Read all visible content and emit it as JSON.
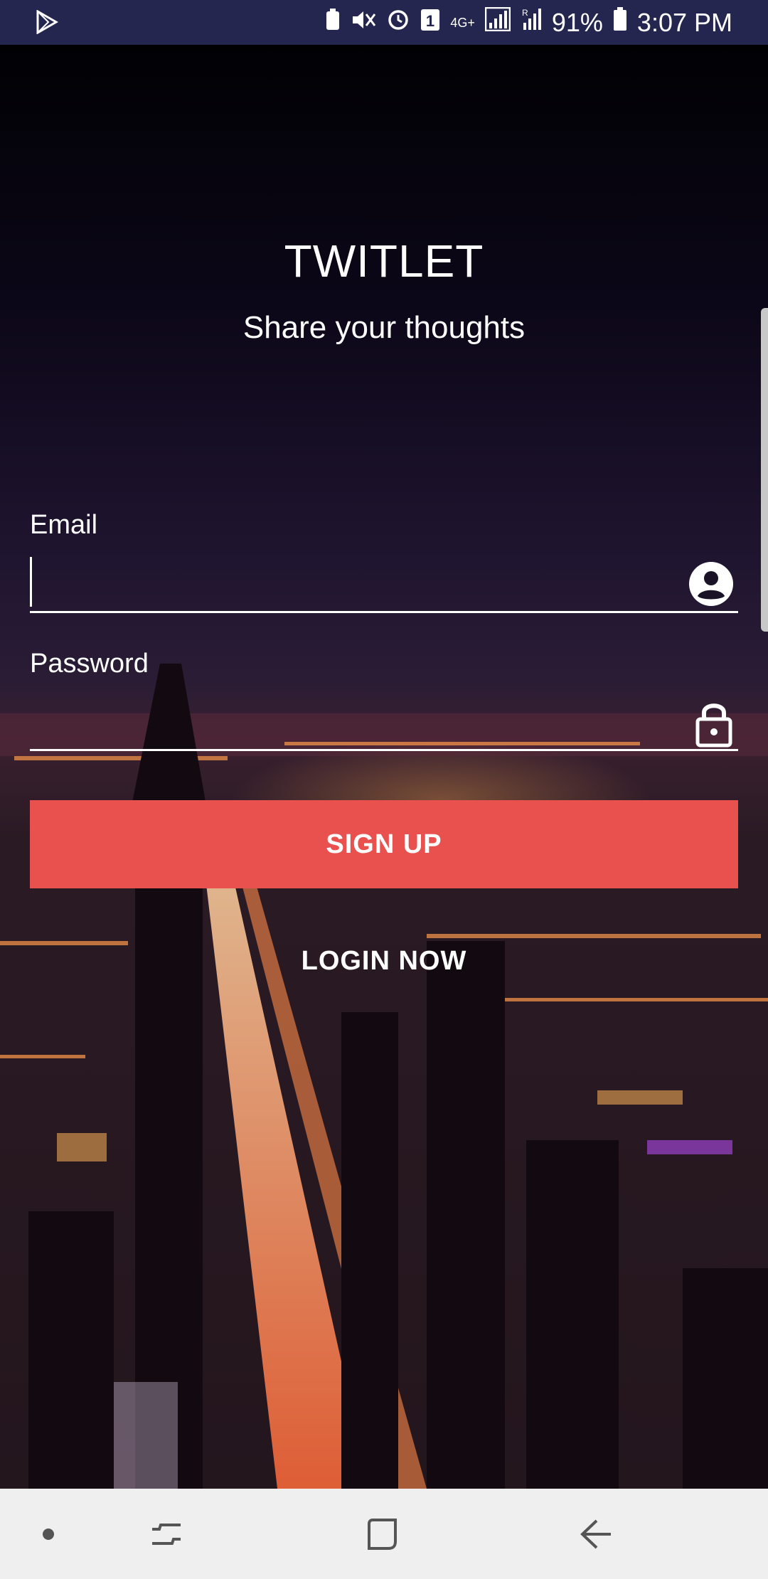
{
  "status_bar": {
    "left_icon": "play-store-icon",
    "icons": [
      "battery-saver-icon",
      "mute-icon",
      "alarm-icon",
      "sim-1-icon",
      "network-4g-icon",
      "signal-icon",
      "roaming-signal-icon"
    ],
    "network_label": "4G+",
    "sim_label": "1",
    "battery": "91%",
    "time": "3:07 PM"
  },
  "header": {
    "title": "TWITLET",
    "tagline": "Share your thoughts"
  },
  "form": {
    "email_label": "Email",
    "email_value": "",
    "email_icon": "account-circle-icon",
    "password_label": "Password",
    "password_value": "",
    "password_icon": "lock-icon",
    "signup_label": "SIGN UP",
    "login_label": "LOGIN NOW"
  },
  "nav_bar": {
    "icons": [
      "dot-icon",
      "recents-icon",
      "home-icon",
      "back-icon"
    ]
  },
  "colors": {
    "status_bar": "#25264f",
    "signup_button": "#e9514f",
    "nav_bar": "#efefef"
  }
}
